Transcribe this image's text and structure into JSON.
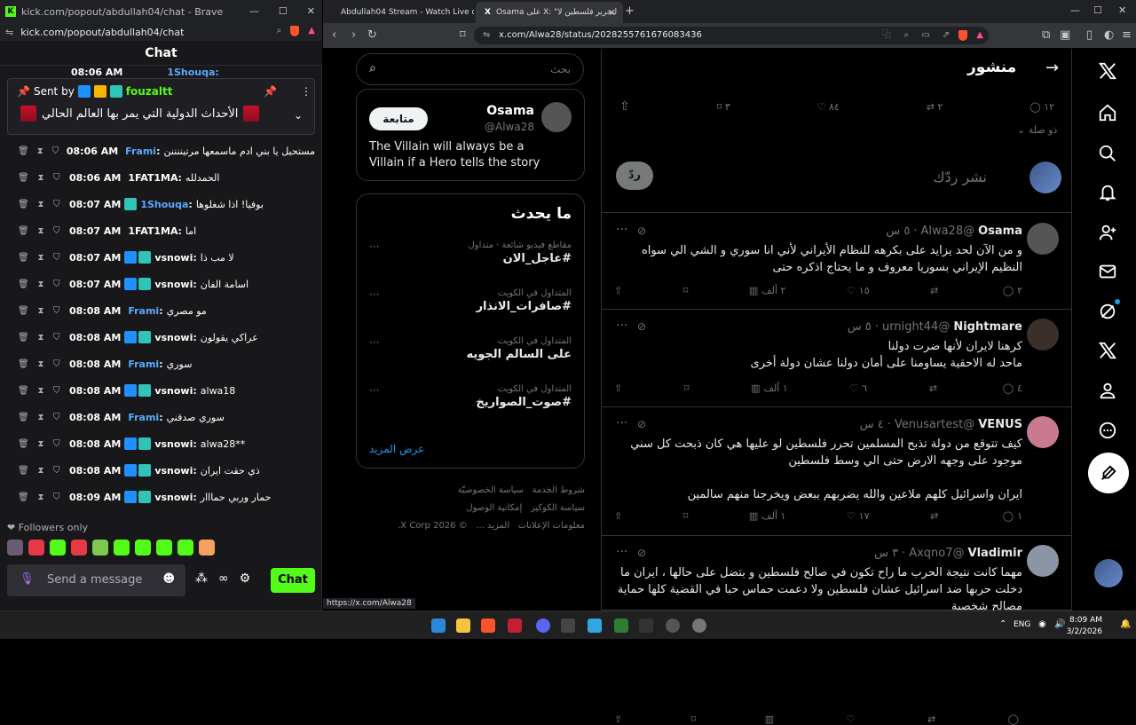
{
  "left_window": {
    "title": "kick.com/popout/abdullah04/chat - Brave",
    "url": "kick.com/popout/abdullah04/chat",
    "chat_header": "Chat",
    "top_partial_time": "08:06 AM",
    "top_partial_name": "1Shouqa:",
    "pinned": {
      "sent_by_label": "Sent by",
      "sender": "fouzaltt",
      "message": "الأحداث الدولية التي يمر بها العالم الحالي"
    },
    "messages": [
      {
        "time": "08:06 AM",
        "user": "Frami",
        "user_color": "#5aa9ff",
        "badges": [],
        "text": "مستحيل يا بني ادم ماسمعها مرتيننننن"
      },
      {
        "time": "08:06 AM",
        "user": "1FAT1MA",
        "user_color": "#ffffff",
        "badges": [],
        "text": "الحمدلله"
      },
      {
        "time": "08:07 AM",
        "user": "1Shouqa",
        "user_color": "#5aa9ff",
        "badges": [
          "#2ec4b6"
        ],
        "text": "بوفيا! اذا شغلوها"
      },
      {
        "time": "08:07 AM",
        "user": "1FAT1MA",
        "user_color": "#ffffff",
        "badges": [],
        "text": "اما"
      },
      {
        "time": "08:07 AM",
        "user": "vsnowi",
        "user_color": "#ffffff",
        "badges": [
          "#1e90ff",
          "#2ec4b6"
        ],
        "text": "لا مب ذا"
      },
      {
        "time": "08:07 AM",
        "user": "vsnowi",
        "user_color": "#ffffff",
        "badges": [
          "#1e90ff",
          "#2ec4b6"
        ],
        "text": "اسامة الفان"
      },
      {
        "time": "08:08 AM",
        "user": "Frami",
        "user_color": "#5aa9ff",
        "badges": [],
        "text": "مو مصري"
      },
      {
        "time": "08:08 AM",
        "user": "vsnowi",
        "user_color": "#ffffff",
        "badges": [
          "#1e90ff",
          "#2ec4b6"
        ],
        "text": "عراكي يقولون"
      },
      {
        "time": "08:08 AM",
        "user": "Frami",
        "user_color": "#5aa9ff",
        "badges": [],
        "text": "سوري"
      },
      {
        "time": "08:08 AM",
        "user": "vsnowi",
        "user_color": "#ffffff",
        "badges": [
          "#1e90ff",
          "#2ec4b6"
        ],
        "text": "alwa18"
      },
      {
        "time": "08:08 AM",
        "user": "Frami",
        "user_color": "#5aa9ff",
        "badges": [],
        "text": "سوري صدقني"
      },
      {
        "time": "08:08 AM",
        "user": "vsnowi",
        "user_color": "#ffffff",
        "badges": [
          "#1e90ff",
          "#2ec4b6"
        ],
        "text": "alwa28**"
      },
      {
        "time": "08:08 AM",
        "user": "vsnowi",
        "user_color": "#ffffff",
        "badges": [
          "#1e90ff",
          "#2ec4b6"
        ],
        "text": "ذي حقت ايران"
      },
      {
        "time": "08:09 AM",
        "user": "vsnowi",
        "user_color": "#ffffff",
        "badges": [
          "#1e90ff",
          "#2ec4b6"
        ],
        "text": "حمار وربي حمااار"
      }
    ],
    "followers_only": "Followers only",
    "message_placeholder": "Send a message",
    "chat_button": "Chat",
    "status_url": "https://x.com/Alwa28"
  },
  "right_window": {
    "tabs": [
      {
        "label": "Abdullah04 Stream - Watch Live on K",
        "active": false
      },
      {
        "label": "Osama على X: \"لتحرير فلسطين لا",
        "active": true
      }
    ],
    "url": "x.com/Alwa28/status/2028255761676083436",
    "post_title": "منشور",
    "main_actions": {
      "replies": "١٢",
      "reposts": "٢",
      "likes": "٨٤",
      "bookmarks": "٣"
    },
    "related_label": "ذو صلة",
    "reply_placeholder": "نشر ردّك",
    "reply_button": "ردّ",
    "search_placeholder": "بحث",
    "profile": {
      "name": "Osama",
      "handle": "@Alwa28",
      "follow": "متابعة",
      "bio": "The Villain will always be a Villain if a Hero tells the story"
    },
    "trends_title": "ما يحدث",
    "trends": [
      {
        "category": "مقاطع فيديو شائعة · متداول",
        "name": "#عاجل_الان"
      },
      {
        "category": "المتداول في الكويت",
        "name": "#صافرات_الانذار"
      },
      {
        "category": "المتداول في الكويت",
        "name": "على السالم الجويه"
      },
      {
        "category": "المتداول في الكويت",
        "name": "#صوت_الصواريخ"
      }
    ],
    "show_more": "عرض المزيد",
    "footer": [
      "شروط الخدمة",
      "سياسة الخصوصيّة",
      "سياسة الكوكيز",
      "إمكانية الوصول",
      "معلومات الإعلانات",
      "المزيد ...",
      "© 2026 X Corp."
    ],
    "tweets": [
      {
        "name": "Osama",
        "handle": "@Alwa28",
        "time": "٥ س",
        "text": "و من الآن لحد يزايد على بكرهه للنظام الأيراني لأني انا سوري و الشي الي سواه النظيم الإيراني بسوريا معروف و ما يحتاج اذكره حتى",
        "replies": "٢",
        "reposts": "",
        "likes": "١٥",
        "views": "٢ ألف",
        "avatar_color": "#555555"
      },
      {
        "name": "Nightmare",
        "handle": "@urnight44",
        "time": "٥ س",
        "text": "كرهنا لايران لأنها ضرت دولنا\nماحد له الاحقية يساومنا على أمان دولنا  عشان دولة أخرى",
        "replies": "٤",
        "reposts": "",
        "likes": "٦",
        "views": "١ ألف",
        "avatar_color": "#3b2f2a"
      },
      {
        "name": "VENUS",
        "handle": "@Venusartest",
        "time": "٤ س",
        "text": "كيف تتوقع من دولة تذبح المسلمين تحرر فلسطين لو عليها هي كان ذبحت كل سني موجود على وجهه الارض حتى الي وسط فلسطين\n\nايران واسرائيل كلهم ملاعين والله يضربهم ببعض ويخرجنا منهم سالمين",
        "replies": "١",
        "reposts": "",
        "likes": "١٧",
        "views": "١ ألف",
        "avatar_color": "#c97a8f"
      },
      {
        "name": "Vladimir",
        "handle": "@Axqno7",
        "time": "٣ س",
        "text": "مهما كانت نتيجة الحرب ما راح تكون في صالح فلسطين و بتضل على حالها ، ايران ما دخلت حربها ضد اسرائيل عشان فلسطين  ولا دعمت حماس حبا في القضية كلها حماية مصالح شخصية",
        "replies": "",
        "reposts": "",
        "likes": "",
        "views": "",
        "avatar_color": "#8a95a5"
      }
    ]
  },
  "taskbar": {
    "language": "ENG",
    "time": "8:09 AM",
    "date": "3/2/2026"
  }
}
